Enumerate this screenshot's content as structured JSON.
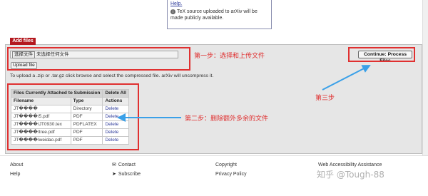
{
  "notice": {
    "link_text": "Help.",
    "info_text": "TeX source uploaded to arXiv will be made publicly available."
  },
  "add_files": {
    "tab_label": "Add files",
    "choose_button": "选择文件",
    "no_file_text": "未选择任何文件",
    "upload_button": "Upload file",
    "instructions": "To upload a .zip or .tar.gz click browse and select the compressed file. arXiv will uncompress it.",
    "continue_button": "Continue: Process Files"
  },
  "files_table": {
    "caption": "Files Currently Attached to Submission",
    "delete_all": "Delete All",
    "columns": [
      "Filename",
      "Type",
      "Actions"
    ],
    "rows": [
      {
        "filename": "JT����",
        "type": "Directory",
        "action": "Delete"
      },
      {
        "filename": "JT����/5.pdf",
        "type": "PDF",
        "action": "Delete"
      },
      {
        "filename": "JT����/JT0930.tex",
        "type": "PDFLATEX",
        "action": "Delete"
      },
      {
        "filename": "JT����/tree.pdf",
        "type": "PDF",
        "action": "Delete"
      },
      {
        "filename": "JT����/weidao.pdf",
        "type": "PDF",
        "action": "Delete"
      }
    ]
  },
  "annotations": {
    "step1": "第一步：选择和上传文件",
    "step2": "第二步：删除额外多余的文件",
    "step3": "第三步"
  },
  "footer": {
    "about": "About",
    "help": "Help",
    "contact": "Contact",
    "subscribe": "Subscribe",
    "copyright": "Copyright",
    "privacy": "Privacy Policy",
    "accessibility": "Web Accessibility Assistance",
    "watermark": "知乎 @Tough-88"
  },
  "colors": {
    "tab_red": "#b4191f",
    "annotation_red": "#e03030",
    "arrow_blue": "#3aa0e8",
    "link_blue": "#2d3a9a"
  }
}
